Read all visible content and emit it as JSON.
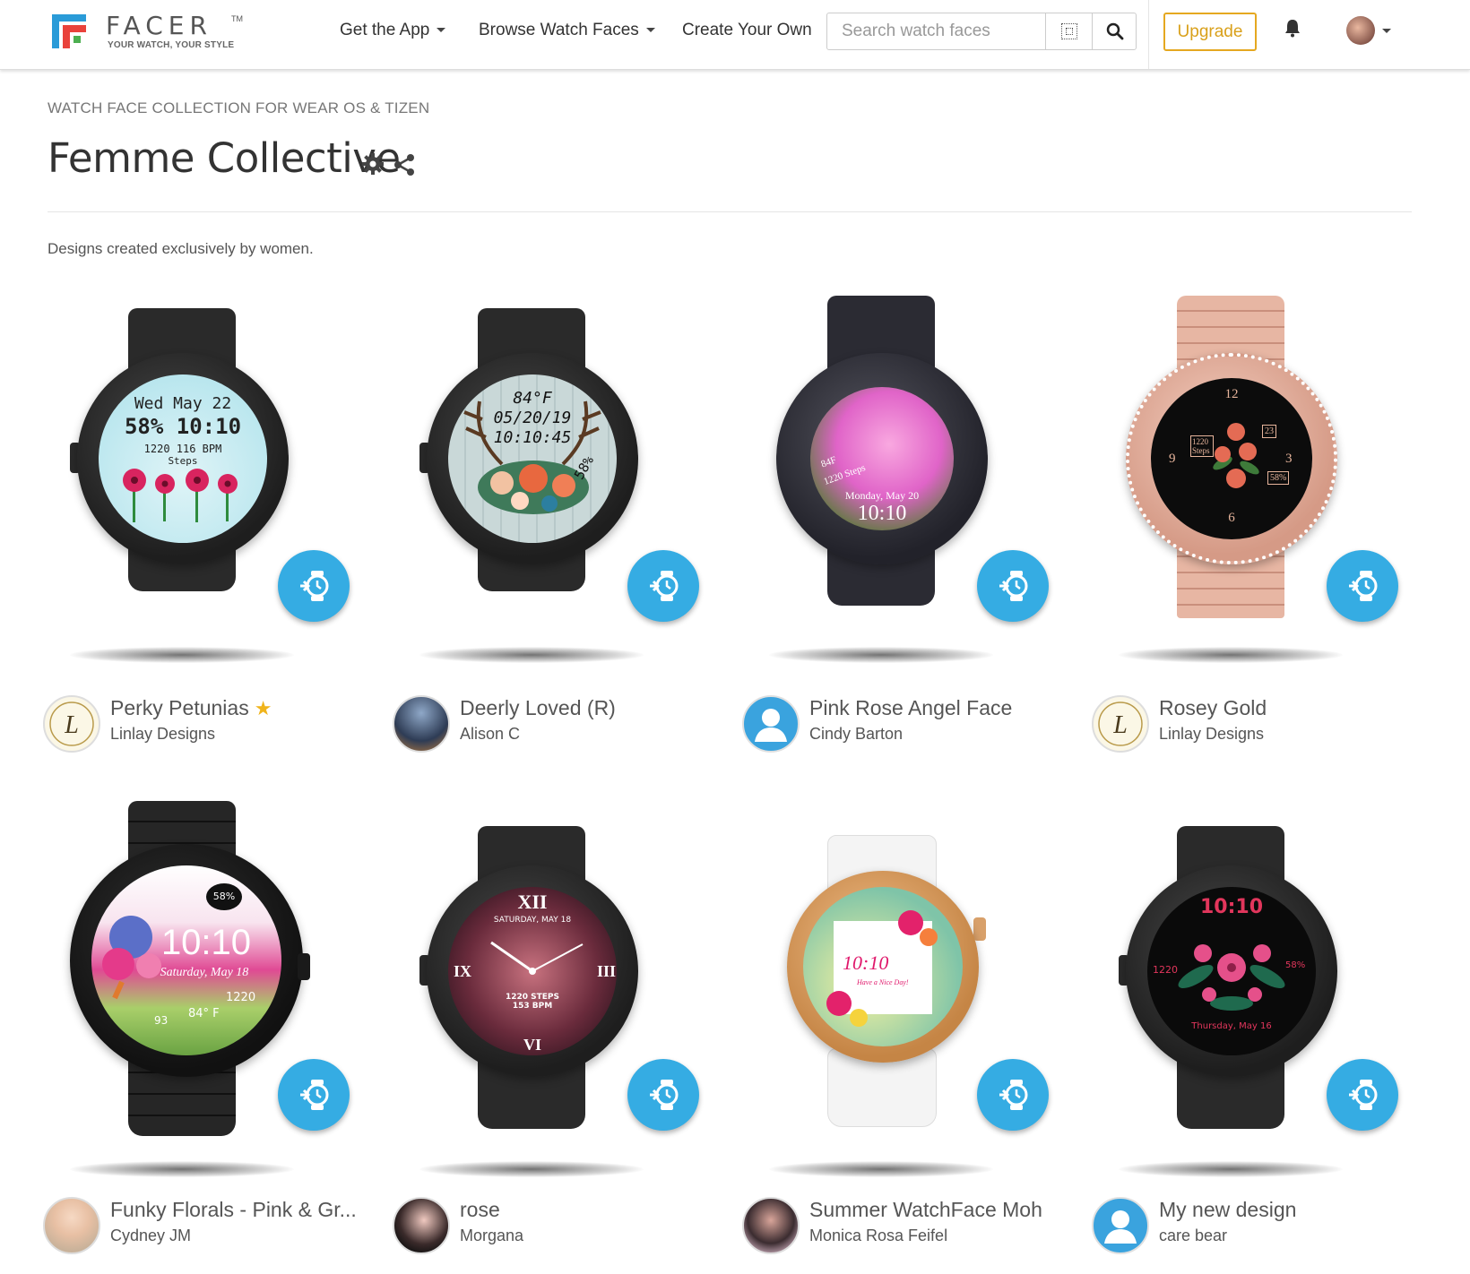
{
  "nav": {
    "logo_word": "FACER",
    "logo_tm": "TM",
    "logo_tagline": "YOUR WATCH, YOUR STYLE",
    "get_app": "Get the App",
    "browse": "Browse Watch Faces",
    "create": "Create Your Own",
    "search_placeholder": "Search watch faces",
    "upgrade": "Upgrade"
  },
  "header": {
    "eyebrow": "WATCH FACE COLLECTION FOR WEAR OS & TIZEN",
    "title": "Femme Collective",
    "description": "Designs created exclusively by women."
  },
  "colors": {
    "accent_blue": "#35ace3",
    "upgrade_gold": "#e5a820",
    "star_gold": "#f0b41c"
  },
  "cards": [
    {
      "name": "Perky Petunias",
      "author": "Linlay Designs",
      "featured": true,
      "dial": {
        "l1": "Wed May 22",
        "l2": "58% 10:10",
        "l3": "1220   116 BPM",
        "l4": "Steps"
      }
    },
    {
      "name": "Deerly Loved (R)",
      "author": "Alison C",
      "featured": false,
      "dial": {
        "l1": "84°F",
        "l2": "05/20/19",
        "l3": "10:10:45",
        "l4": "58%"
      }
    },
    {
      "name": "Pink Rose Angel Face",
      "author": "Cindy Barton",
      "featured": false,
      "dial": {
        "l1": "84F",
        "l2": "1220 Steps",
        "l3": "Monday, May 20",
        "l4": "10:10"
      }
    },
    {
      "name": "Rosey Gold",
      "author": "Linlay Designs",
      "featured": false,
      "dial": {
        "l1": "12",
        "l2": "1220 Steps",
        "l3": "23",
        "l4": "58%",
        "l5": "9",
        "l6": "3",
        "l7": "6"
      }
    },
    {
      "name": "Funky Florals - Pink & Gr...",
      "author": "Cydney JM",
      "featured": false,
      "dial": {
        "l1": "58%",
        "l2": "10:10",
        "l3": "Saturday, May 18",
        "l4": "1220",
        "l5": "84° F",
        "l6": "93"
      }
    },
    {
      "name": "rose",
      "author": "Morgana",
      "featured": false,
      "dial": {
        "l1": "XII",
        "l2": "SATURDAY, MAY 18",
        "l3": "1220 STEPS",
        "l4": "153 BPM"
      }
    },
    {
      "name": "Summer WatchFace Moh",
      "author": "Monica Rosa Feifel",
      "featured": false,
      "dial": {
        "l1": "10:10",
        "l2": "Have a Nice Day!"
      }
    },
    {
      "name": "My new design",
      "author": "care bear",
      "featured": false,
      "dial": {
        "l1": "10:10",
        "l2": "1220",
        "l3": "58%",
        "l4": "Thursday, May 16"
      }
    }
  ]
}
